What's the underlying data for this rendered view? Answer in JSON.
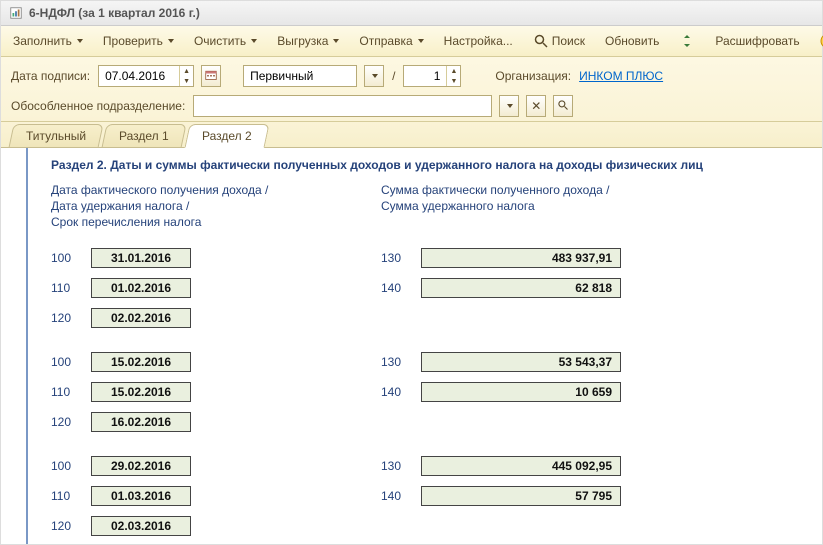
{
  "window": {
    "title": "6-НДФЛ (за 1 квартал 2016 г.)"
  },
  "toolbar": {
    "fill": "Заполнить",
    "check": "Проверить",
    "clear": "Очистить",
    "export": "Выгрузка",
    "send": "Отправка",
    "setup": "Настройка...",
    "search": "Поиск",
    "refresh": "Обновить",
    "decode": "Расшифровать"
  },
  "form": {
    "sign_date_label": "Дата подписи:",
    "sign_date": "07.04.2016",
    "doc_type": "Первичный",
    "slash": "/",
    "correction_no": "1",
    "org_label": "Организация:",
    "org_name": "ИНКОМ ПЛЮС",
    "subdiv_label": "Обособленное подразделение:",
    "subdiv_value": ""
  },
  "tabs": {
    "t1": "Титульный",
    "t2": "Раздел 1",
    "t3": "Раздел 2"
  },
  "section": {
    "title": "Раздел 2.  Даты и суммы фактически полученных доходов и удержанного налога на доходы физических лиц",
    "left_h1": "Дата фактического получения дохода /",
    "left_h2": "Дата удержания налога /",
    "left_h3": "Срок перечисления налога",
    "right_h1": "Сумма фактически полученного дохода /",
    "right_h2": "Сумма удержанного налога"
  },
  "codes": {
    "c100": "100",
    "c110": "110",
    "c120": "120",
    "c130": "130",
    "c140": "140"
  },
  "data": {
    "g1": {
      "d100": "31.01.2016",
      "d110": "01.02.2016",
      "d120": "02.02.2016",
      "s130": "483 937,91",
      "s140": "62 818"
    },
    "g2": {
      "d100": "15.02.2016",
      "d110": "15.02.2016",
      "d120": "16.02.2016",
      "s130": "53 543,37",
      "s140": "10 659"
    },
    "g3": {
      "d100": "29.02.2016",
      "d110": "01.03.2016",
      "d120": "02.03.2016",
      "s130": "445 092,95",
      "s140": "57 795"
    }
  }
}
